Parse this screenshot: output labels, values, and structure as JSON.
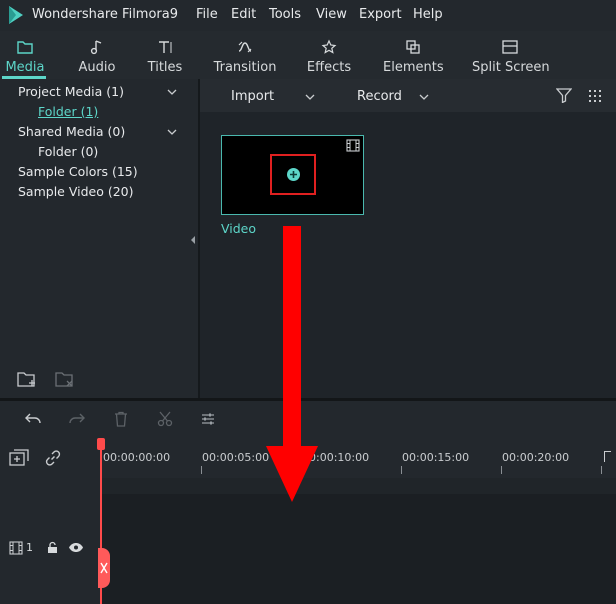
{
  "app": {
    "title": "Wondershare Filmora9",
    "logo_icon": "filmora-logo",
    "accent_color": "#5dd6c9"
  },
  "menu": [
    "File",
    "Edit",
    "Tools",
    "View",
    "Export",
    "Help"
  ],
  "tabs": [
    {
      "label": "Media",
      "icon": "folder-icon",
      "active": true
    },
    {
      "label": "Audio",
      "icon": "music-note-icon",
      "active": false
    },
    {
      "label": "Titles",
      "icon": "text-icon",
      "active": false
    },
    {
      "label": "Transition",
      "icon": "transition-icon",
      "active": false
    },
    {
      "label": "Effects",
      "icon": "effects-icon",
      "active": false
    },
    {
      "label": "Elements",
      "icon": "elements-icon",
      "active": false
    },
    {
      "label": "Split Screen",
      "icon": "split-screen-icon",
      "active": false
    }
  ],
  "tree": {
    "project_media": "Project Media (1)",
    "project_folder": "Folder (1)",
    "shared_media": "Shared Media (0)",
    "shared_folder": "Folder (0)",
    "sample_colors": "Sample Colors (15)",
    "sample_video": "Sample Video (20)"
  },
  "media_toolbar": {
    "import": "Import",
    "record": "Record"
  },
  "media_items": [
    {
      "label": "Video"
    }
  ],
  "timeline": {
    "ticks": [
      "00:00:00:00",
      "00:00:05:00",
      "00:00:10:00",
      "00:00:15:00",
      "00:00:20:00"
    ],
    "track_number": "1"
  },
  "annotation": {
    "arrow_color": "#ff0000",
    "highlight_color": "#e02020"
  }
}
